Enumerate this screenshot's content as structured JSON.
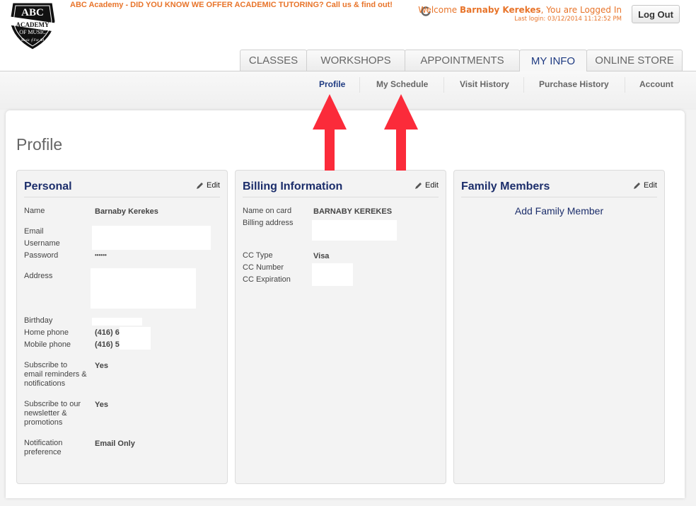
{
  "header": {
    "logo": {
      "line1": "ABC",
      "line2": "ACADEMY",
      "line3": "OF MUSIC",
      "tagline": "Music For All"
    },
    "promo": "ABC Academy - DID YOU KNOW WE OFFER ACADEMIC TUTORING? Call us & find out!",
    "welcome_prefix": "Welcome ",
    "user_name": "Barnaby Kerekes",
    "welcome_suffix": ", You are Logged In",
    "last_login": "Last login: 03/12/2014 11:12:52 PM",
    "logout_label": "Log Out"
  },
  "tabs": [
    {
      "label": "CLASSES",
      "active": false
    },
    {
      "label": "WORKSHOPS",
      "active": false
    },
    {
      "label": "APPOINTMENTS",
      "active": false
    },
    {
      "label": "MY INFO",
      "active": true
    },
    {
      "label": "ONLINE STORE",
      "active": false
    }
  ],
  "subnav": [
    {
      "label": "Profile",
      "active": true
    },
    {
      "label": "My Schedule",
      "active": false
    },
    {
      "label": "Visit History",
      "active": false
    },
    {
      "label": "Purchase History",
      "active": false
    },
    {
      "label": "Account",
      "active": false
    }
  ],
  "page_title": "Profile",
  "edit_label": "Edit",
  "personal": {
    "title": "Personal",
    "name_label": "Name",
    "name_value": "Barnaby Kerekes",
    "email_label": "Email",
    "username_label": "Username",
    "password_label": "Password",
    "password_value": "••••••",
    "address_label": "Address",
    "birthday_label": "Birthday",
    "home_phone_label": "Home phone",
    "home_phone_value": "(416) 6",
    "mobile_phone_label": "Mobile phone",
    "mobile_phone_value": "(416) 5",
    "subscribe_reminders_label": "Subscribe to email reminders & notifications",
    "subscribe_reminders_value": "Yes",
    "subscribe_newsletter_label": "Subscribe to our newsletter & promotions",
    "subscribe_newsletter_value": "Yes",
    "notification_label": "Notification preference",
    "notification_value": "Email Only"
  },
  "billing": {
    "title": "Billing Information",
    "name_on_card_label": "Name on card",
    "name_on_card_value": "BARNABY KEREKES",
    "billing_address_label": "Billing address",
    "cc_type_label": "CC Type",
    "cc_type_value": "Visa",
    "cc_number_label": "CC Number",
    "cc_expiration_label": "CC Expiration"
  },
  "family": {
    "title": "Family Members",
    "add_label": "Add Family Member"
  },
  "colors": {
    "accent_orange": "#e8742a",
    "nav_blue": "#1c2e6b",
    "arrow_red": "#fb2b3a"
  }
}
